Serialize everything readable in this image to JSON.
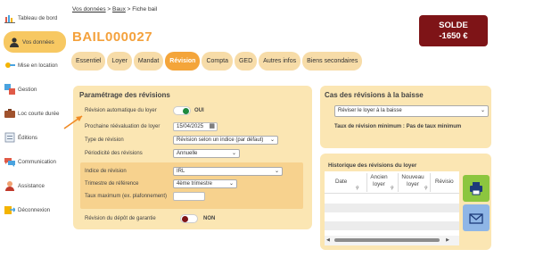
{
  "sidebar": {
    "items": [
      {
        "label": "Tableau de bord",
        "icon": "dashboard-icon"
      },
      {
        "label": "Vos données",
        "icon": "user-icon"
      },
      {
        "label": "Mise en location",
        "icon": "key-icon"
      },
      {
        "label": "Gestion",
        "icon": "gestion-icon"
      },
      {
        "label": "Loc courte durée",
        "icon": "suitcase-icon"
      },
      {
        "label": "Éditions",
        "icon": "edit-icon"
      },
      {
        "label": "Communication",
        "icon": "chat-icon"
      },
      {
        "label": "Assistance",
        "icon": "assistance-icon"
      },
      {
        "label": "Déconnexion",
        "icon": "logout-icon"
      }
    ]
  },
  "breadcrumb": {
    "link1": "Vos données",
    "sep1": " > ",
    "link2": "Baux",
    "sep2": " > ",
    "current": "Fiche bail"
  },
  "page_title": "BAIL000027",
  "solde": {
    "label": "SOLDE",
    "amount": "-1650 €"
  },
  "tabs": [
    "Essentiel",
    "Loyer",
    "Mandat",
    "Révision",
    "Compta",
    "GED",
    "Autres infos",
    "Biens secondaires"
  ],
  "revisions": {
    "title": "Paramétrage des révisions",
    "auto_label": "Révision automatique du loyer",
    "auto_value": "OUI",
    "prochaine_label": "Prochaine réévaluation de loyer",
    "prochaine_value": "15/04/2025",
    "type_label": "Type de révision",
    "type_value": "Révision selon un indice (par défaut)",
    "periodicite_label": "Périodicité des révisions",
    "periodicite_value": "Annuelle",
    "indice_label": "Indice de révision",
    "indice_value": "IRL",
    "trimestre_label": "Trimestre de référence",
    "trimestre_value": "4ème trimestre",
    "taux_label": "Taux maximum (ex. plafonnement)",
    "taux_value": "",
    "depot_label": "Révision du dépôt de garantie",
    "depot_value": "NON"
  },
  "baisse": {
    "title": "Cas des révisions à la baisse",
    "select_value": "Réviser le loyer à la baisse",
    "taux_text": "Taux de révision minimum : Pas de taux minimum"
  },
  "historique": {
    "title": "Historique des révisions du loyer",
    "columns": [
      "Date",
      "Ancien loyer",
      "Nouveau loyer",
      "Révisio"
    ]
  },
  "colors": {
    "accent": "#f4a53a",
    "solde_bg": "#7e1417",
    "toggle_on": "#1e8a3e",
    "toggle_off": "#7e1417"
  }
}
